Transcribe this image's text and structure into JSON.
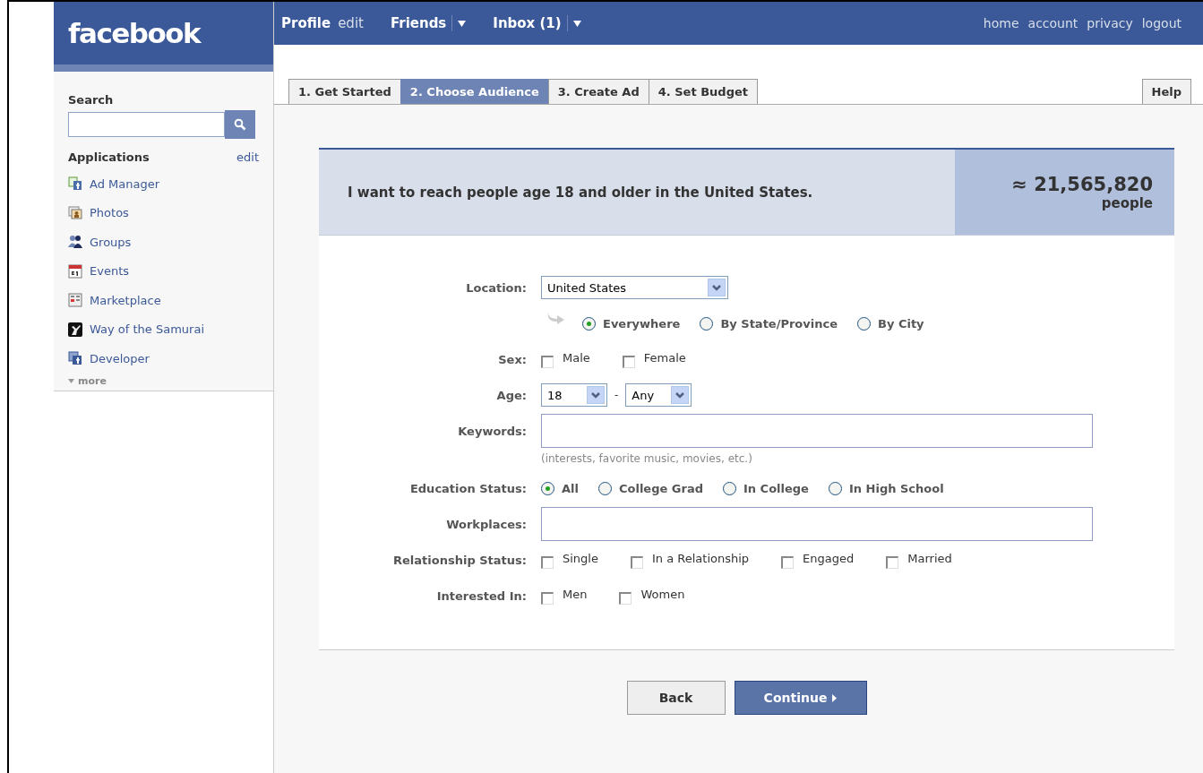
{
  "logo": "facebook",
  "top_nav": {
    "left": [
      {
        "label": "Profile",
        "kind": "bold"
      },
      {
        "label": "edit",
        "kind": "plain"
      },
      {
        "label": "Friends",
        "kind": "menu"
      },
      {
        "label": "Inbox (1)",
        "kind": "menu"
      }
    ],
    "right": [
      "home",
      "account",
      "privacy",
      "logout"
    ]
  },
  "sidebar": {
    "search_label": "Search",
    "applications_label": "Applications",
    "edit_link": "edit",
    "apps": [
      {
        "label": "Ad Manager",
        "kind": "ads"
      },
      {
        "label": "Photos",
        "kind": "photos"
      },
      {
        "label": "Groups",
        "kind": "groups"
      },
      {
        "label": "Events",
        "kind": "events"
      },
      {
        "label": "Marketplace",
        "kind": "marketplace"
      },
      {
        "label": "Way of the Samurai",
        "kind": "samurai"
      },
      {
        "label": "Developer",
        "kind": "developer"
      }
    ],
    "more": "more"
  },
  "tabs": [
    {
      "label": "1. Get Started",
      "selected": false
    },
    {
      "label": "2. Choose Audience",
      "selected": true
    },
    {
      "label": "3. Create Ad",
      "selected": false
    },
    {
      "label": "4. Set Budget",
      "selected": false
    }
  ],
  "help": "Help",
  "summary": {
    "text": "I want to reach people age 18 and older in the United States.",
    "count": "≈ 21,565,820",
    "unit": "people"
  },
  "form": [
    {
      "kind": "location",
      "label": "Location:",
      "value": "United States",
      "options": [
        {
          "label": "Everywhere",
          "selected": true
        },
        {
          "label": "By State/Province",
          "selected": false
        },
        {
          "label": "By City",
          "selected": false
        }
      ]
    },
    {
      "kind": "checks",
      "label": "Sex:",
      "options": [
        {
          "label": "Male",
          "checked": false
        },
        {
          "label": "Female",
          "checked": false
        }
      ]
    },
    {
      "kind": "range",
      "label": "Age:",
      "from": "18",
      "separator": "-",
      "to": "Any"
    },
    {
      "kind": "text",
      "label": "Keywords:",
      "note": "(interests, favorite music, movies, etc.)"
    },
    {
      "kind": "radios",
      "label": "Education Status:",
      "options": [
        {
          "label": "All",
          "selected": true
        },
        {
          "label": "College Grad",
          "selected": false
        },
        {
          "label": "In College",
          "selected": false
        },
        {
          "label": "In High School",
          "selected": false
        }
      ]
    },
    {
      "kind": "text",
      "label": "Workplaces:"
    },
    {
      "kind": "checks",
      "label": "Relationship Status:",
      "options": [
        {
          "label": "Single",
          "checked": false
        },
        {
          "label": "In a Relationship",
          "checked": false
        },
        {
          "label": "Engaged",
          "checked": false
        },
        {
          "label": "Married",
          "checked": false
        }
      ]
    },
    {
      "kind": "checks",
      "label": "Interested In:",
      "options": [
        {
          "label": "Men",
          "checked": false
        },
        {
          "label": "Women",
          "checked": false
        }
      ]
    }
  ],
  "buttons": [
    {
      "label": "Back",
      "kind": "secondary"
    },
    {
      "label": "Continue",
      "kind": "primary"
    }
  ]
}
